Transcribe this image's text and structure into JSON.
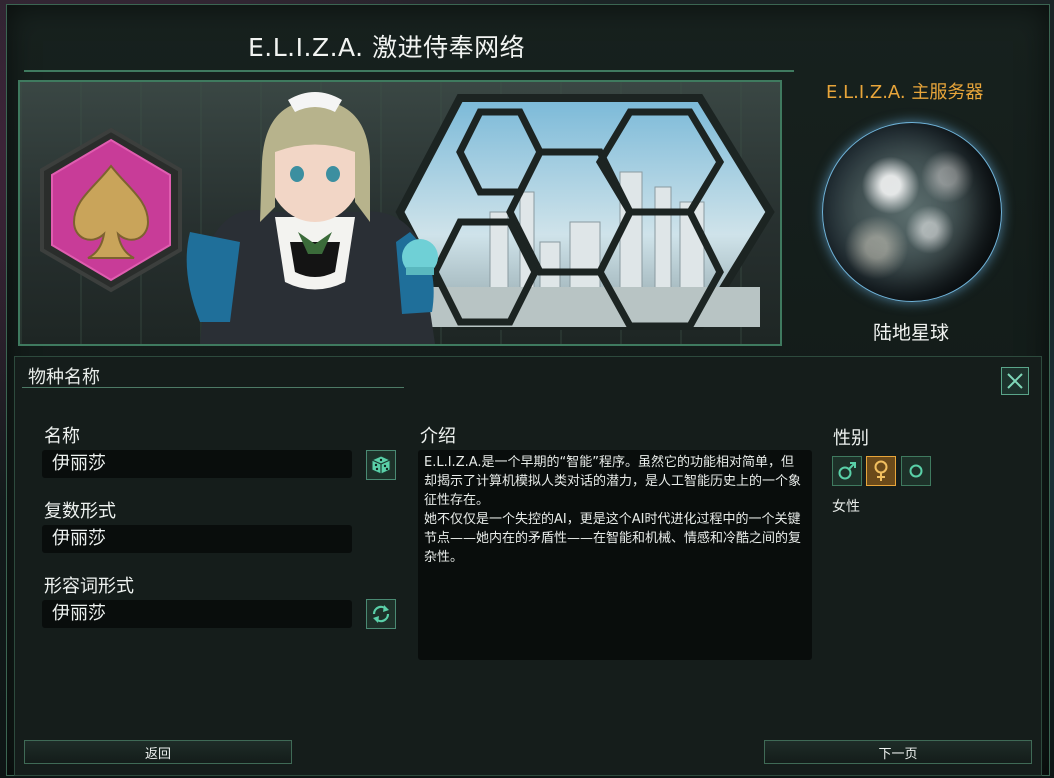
{
  "window": {
    "title": "E.L.I.Z.A. 激进侍奉网络"
  },
  "planet": {
    "heading": "E.L.I.Z.A. 主服务器",
    "type": "陆地星球"
  },
  "panel": {
    "header": "物种名称",
    "name": {
      "label": "名称",
      "value": "伊丽莎"
    },
    "plural": {
      "label": "复数形式",
      "value": "伊丽莎"
    },
    "adjective": {
      "label": "形容词形式",
      "value": "伊丽莎"
    },
    "description": {
      "label": "介绍",
      "paragraph1": "E.L.I.Z.A.是一个早期的“智能”程序。虽然它的功能相对简单，但却揭示了计算机模拟人类对话的潜力，是人工智能历史上的一个象征性存在。",
      "paragraph2": "她不仅仅是一个失控的AI，更是这个AI时代进化过程中的一个关键节点——她内在的矛盾性——在智能和机械、情感和冷酷之间的复杂性。"
    },
    "gender": {
      "label": "性别",
      "options": [
        "male",
        "female",
        "indeterminable"
      ],
      "selected": "female",
      "selected_label": "女性"
    }
  },
  "footer": {
    "back_label": "返回",
    "next_label": "下一页"
  },
  "colors": {
    "accent_orange": "#e8a53a",
    "border_green": "#3f7a5f",
    "emblem_pink": "#c83c98",
    "emblem_gold": "#c9a45a"
  }
}
